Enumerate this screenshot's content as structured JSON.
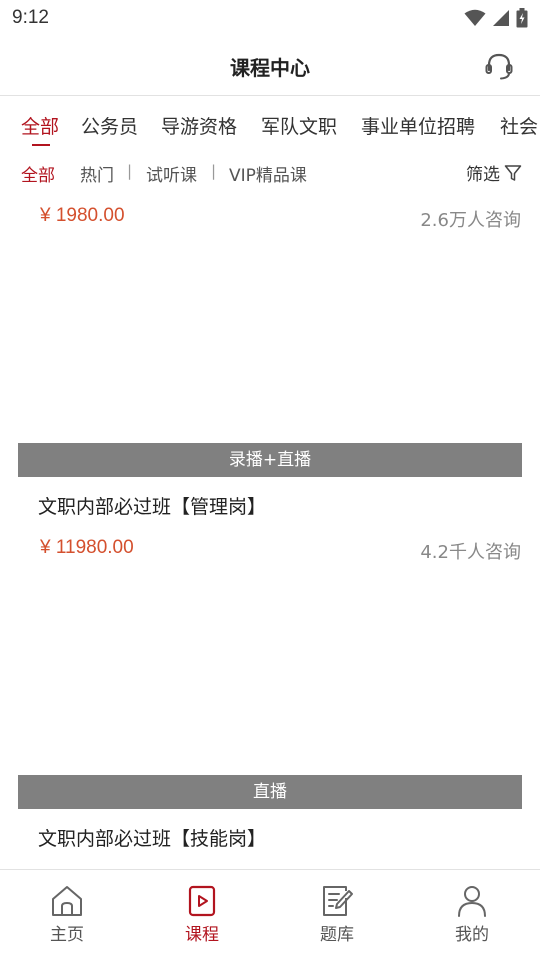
{
  "status_bar": {
    "time": "9:12"
  },
  "header": {
    "title": "课程中心",
    "support_icon": "headset-icon"
  },
  "category_tabs": [
    {
      "label": "全部",
      "active": true
    },
    {
      "label": "公务员",
      "active": false
    },
    {
      "label": "导游资格",
      "active": false
    },
    {
      "label": "军队文职",
      "active": false
    },
    {
      "label": "事业单位招聘",
      "active": false
    },
    {
      "label": "社会",
      "active": false
    }
  ],
  "filters": {
    "items": [
      {
        "label": "全部",
        "active": true
      },
      {
        "label": "热门",
        "active": false
      },
      {
        "label": "试听课",
        "active": false
      },
      {
        "label": "VIP精品课",
        "active": false
      }
    ],
    "separator": "|",
    "filter_label": "筛选",
    "filter_icon": "funnel-icon"
  },
  "courses": [
    {
      "tag": "",
      "title": "",
      "price": "¥ 1980.00",
      "consult": "2.6万人咨询"
    },
    {
      "tag": "录播+直播",
      "title": "文职内部必过班【管理岗】",
      "price": "¥ 11980.00",
      "consult": "4.2千人咨询"
    },
    {
      "tag": "直播",
      "title": "文职内部必过班【技能岗】",
      "price": "",
      "consult": ""
    }
  ],
  "bottom_nav": [
    {
      "label": "主页",
      "icon": "home-icon",
      "active": false
    },
    {
      "label": "课程",
      "icon": "course-play-icon",
      "active": true
    },
    {
      "label": "题库",
      "icon": "question-bank-icon",
      "active": false
    },
    {
      "label": "我的",
      "icon": "profile-icon",
      "active": false
    }
  ],
  "colors": {
    "accent": "#b2141f",
    "price": "#d4502e",
    "tag_bg": "#808080"
  }
}
